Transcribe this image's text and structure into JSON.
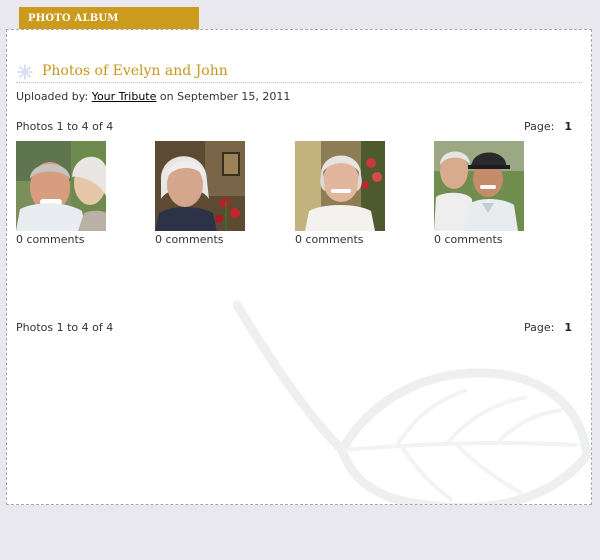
{
  "tab": {
    "label": "PHOTO ALBUM"
  },
  "album": {
    "title": "Photos of Evelyn and John",
    "uploaded_prefix": "Uploaded by:",
    "uploader": "Your Tribute",
    "uploaded_suffix": "on September 15, 2011"
  },
  "pagination": {
    "summary": "Photos 1 to 4 of 4",
    "page_label": "Page:",
    "page_number": "1"
  },
  "photos": [
    {
      "comments": "0 comments",
      "description": "couple-outdoors"
    },
    {
      "comments": "0 comments",
      "description": "woman-white-hair-indoors"
    },
    {
      "comments": "0 comments",
      "description": "woman-smiling-flowers"
    },
    {
      "comments": "0 comments",
      "description": "couple-man-in-hat"
    }
  ],
  "colors": {
    "accent": "#cc9a1d",
    "title": "#c8961b",
    "background": "#e9e8ee",
    "panel": "#ffffff"
  },
  "icons": {
    "title": "snowflake-icon",
    "watermark": "leaf-icon"
  }
}
